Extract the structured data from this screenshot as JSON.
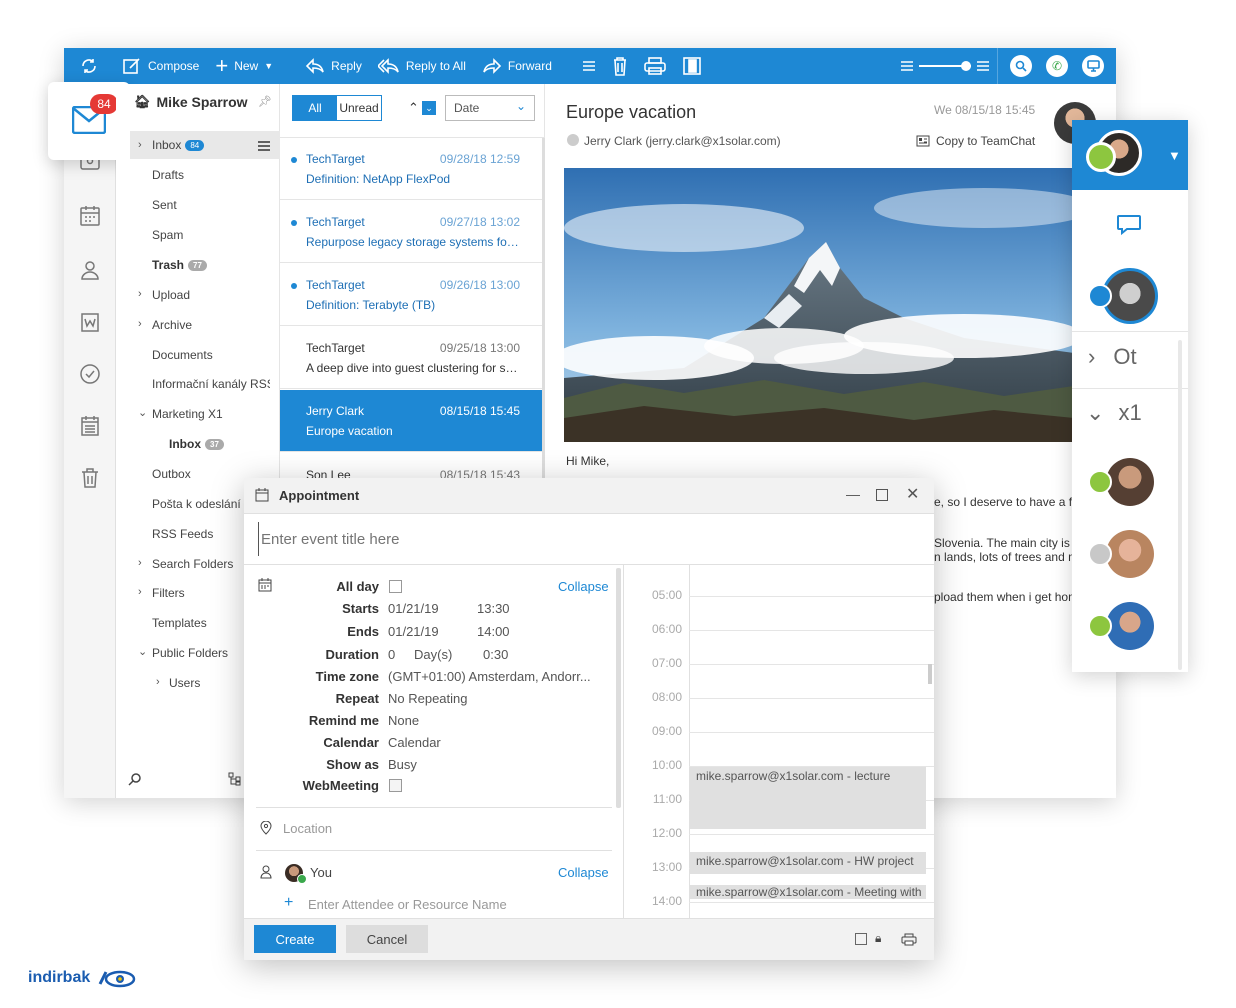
{
  "toolbar": {
    "compose": "Compose",
    "new": "New",
    "reply": "Reply",
    "reply_all": "Reply to All",
    "forward": "Forward"
  },
  "mail_icon_badge": "84",
  "account": {
    "name": "Mike Sparrow"
  },
  "folders": {
    "inbox": "Inbox",
    "inbox_count": "84",
    "drafts": "Drafts",
    "sent": "Sent",
    "spam": "Spam",
    "trash": "Trash",
    "trash_count": "77",
    "upload": "Upload",
    "archive": "Archive",
    "documents": "Documents",
    "rss_channels": "Informační kanály RSS",
    "marketing": "Marketing X1",
    "marketing_inbox": "Inbox",
    "marketing_inbox_count": "37",
    "outbox": "Outbox",
    "posta": "Pošta k odeslání",
    "rss_feeds": "RSS Feeds",
    "search_folders": "Search Folders",
    "filters": "Filters",
    "templates": "Templates",
    "public_folders": "Public Folders",
    "users": "Users"
  },
  "list_filters": {
    "all": "All",
    "unread": "Unread",
    "sort": "Date"
  },
  "messages": [
    {
      "from": "TechTarget",
      "date": "09/28/18 12:59",
      "subject": "Definition: NetApp FlexPod"
    },
    {
      "from": "TechTarget",
      "date": "09/27/18 13:02",
      "subject": "Repurpose legacy storage systems for r..."
    },
    {
      "from": "TechTarget",
      "date": "09/26/18 13:00",
      "subject": "Definition: Terabyte (TB)"
    },
    {
      "from": "TechTarget",
      "date": "09/25/18 13:00",
      "subject": "A deep dive into guest clustering for shar..."
    },
    {
      "from": "Jerry Clark",
      "date": "08/15/18 15:45",
      "subject": "Europe vacation"
    },
    {
      "from": "Son Lee",
      "date": "08/15/18 15:43",
      "subject": ""
    }
  ],
  "reading": {
    "subject": "Europe vacation",
    "date": "We 08/15/18 15:45",
    "sender": "Jerry Clark (jerry.clark@x1solar.com)",
    "copy_to": "Copy to TeamChat",
    "greeting": "Hi Mike,",
    "line1": "e, so I deserve to have a fu",
    "line2": "Slovenia. The main city is",
    "line3": "n lands, lots of trees and m",
    "line4": "pload them when i get hom"
  },
  "appointment": {
    "title": "Appointment",
    "placeholder": "Enter event title here",
    "collapse": "Collapse",
    "labels": {
      "all_day": "All day",
      "starts": "Starts",
      "ends": "Ends",
      "duration": "Duration",
      "timezone": "Time zone",
      "repeat": "Repeat",
      "remind": "Remind me",
      "calendar": "Calendar",
      "show_as": "Show as",
      "webmeeting": "WebMeeting"
    },
    "values": {
      "start_date": "01/21/19",
      "start_time": "13:30",
      "end_date": "01/21/19",
      "end_time": "14:00",
      "duration_days": "0",
      "duration_unit": "Day(s)",
      "duration_time": "0:30",
      "timezone": "(GMT+01:00) Amsterdam, Andorr...",
      "repeat": "No Repeating",
      "remind": "None",
      "calendar": "Calendar",
      "show_as": "Busy"
    },
    "location_placeholder": "Location",
    "attendee_you": "You",
    "attendee_placeholder": "Enter Attendee or Resource Name",
    "create": "Create",
    "cancel": "Cancel",
    "hours": [
      "05:00",
      "06:00",
      "07:00",
      "08:00",
      "09:00",
      "10:00",
      "11:00",
      "12:00",
      "13:00",
      "14:00"
    ],
    "events": [
      "mike.sparrow@x1solar.com - lecture",
      "mike.sparrow@x1solar.com - HW project",
      "mike.sparrow@x1solar.com - Meeting with"
    ]
  },
  "chat": {
    "group_ot": "Ot",
    "group_x1": "x1"
  },
  "watermark": "indirbak",
  "colors": {
    "accent": "#1e88d4",
    "online": "#8dc63f",
    "offline": "#c8c8c8",
    "badge_red": "#e53935"
  }
}
